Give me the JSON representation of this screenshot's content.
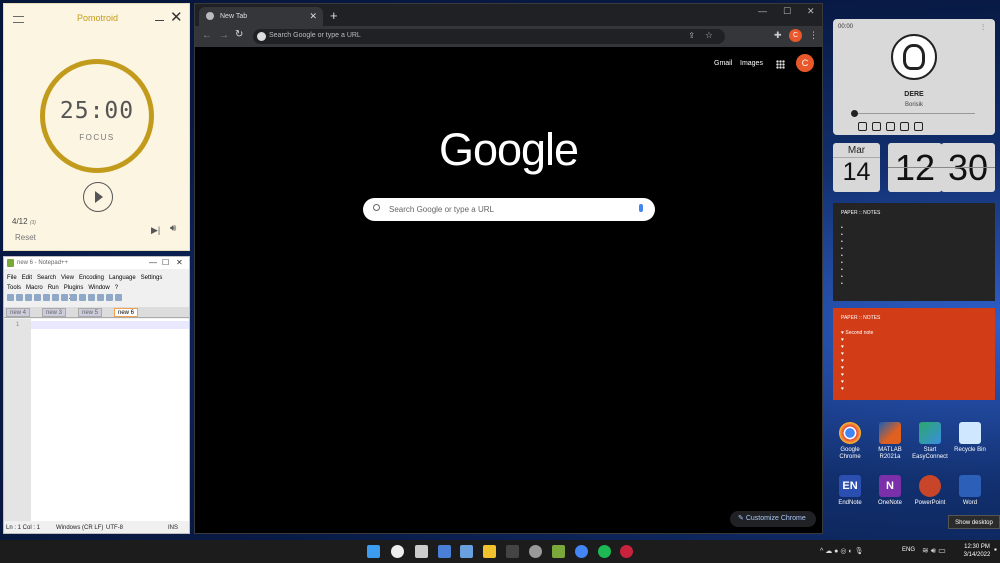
{
  "pomotroid": {
    "title": "Pomotroid",
    "time": "25:00",
    "mode": "FOCUS",
    "round": "4/12",
    "round_small": "(3)",
    "reset": "Reset",
    "ring_color": "#c39b1c"
  },
  "notepad": {
    "title": "new 6 - Notepad++",
    "menus": [
      "File",
      "Edit",
      "Search",
      "View",
      "Encoding",
      "Language",
      "Settings",
      "Tools",
      "Macro",
      "Run",
      "Plugins",
      "Window",
      "?",
      "X"
    ],
    "tabs": [
      "new 4",
      "new 3",
      "new 5",
      "new 6"
    ],
    "line_number": "1",
    "status": {
      "pos": "Ln : 1   Col : 1",
      "eol": "Windows (CR LF)",
      "enc": "UTF-8",
      "mode": "INS"
    }
  },
  "chrome": {
    "tab_title": "New Tab",
    "omnibox_placeholder": "Search Google or type a URL",
    "avatar": "C",
    "gmail": "Gmail",
    "images": "Images",
    "logo": "Google",
    "search_placeholder": "Search Google or type a URL",
    "customize": "Customize Chrome",
    "colors": {
      "bg": "#000000",
      "frame": "#202124",
      "avatar": "#e8582a"
    }
  },
  "music": {
    "time": "00:00",
    "song": "DERE",
    "artist": "Borisik"
  },
  "flip_clock": {
    "month": "Mar",
    "day": "14",
    "hour": "12",
    "minute": "30"
  },
  "notes": [
    {
      "header": "PAPER :: NOTES",
      "lines": [
        "•",
        "•",
        "•",
        "•",
        "•",
        "•",
        "•",
        "•",
        "•"
      ],
      "color": "#242424"
    },
    {
      "header": "PAPER :: NOTES",
      "lines": [
        "♥ Second note",
        "♥",
        "♥",
        "♥",
        "♥",
        "♥",
        "♥",
        "♥",
        "♥"
      ],
      "color": "#d23d17"
    }
  ],
  "desktop_icons": [
    {
      "label": "Google Chrome",
      "icon": "chrome-icon",
      "color": "#e8eaed"
    },
    {
      "label": "MATLAB R2021a",
      "icon": "matlab-icon",
      "color": "#e06020"
    },
    {
      "label": "Start EasyConnect",
      "icon": "easyconnect-icon",
      "color": "#2aa86a"
    },
    {
      "label": "Recycle Bin",
      "icon": "recycle-bin-icon",
      "color": "#cfe8ff"
    },
    {
      "label": "EndNote",
      "icon": "endnote-icon",
      "color": "#2a4fb0"
    },
    {
      "label": "OneNote",
      "icon": "onenote-icon",
      "color": "#7b2fa8"
    },
    {
      "label": "PowerPoint",
      "icon": "powerpoint-icon",
      "color": "#c8452a"
    },
    {
      "label": "Word",
      "icon": "word-icon",
      "color": "#2b5fb8"
    }
  ],
  "endnote_text": "EN",
  "onenote_text": "N",
  "show_desktop": "Show desktop",
  "taskbar": {
    "lang": "ENG",
    "time": "12:30 PM",
    "date": "3/14/2022"
  }
}
